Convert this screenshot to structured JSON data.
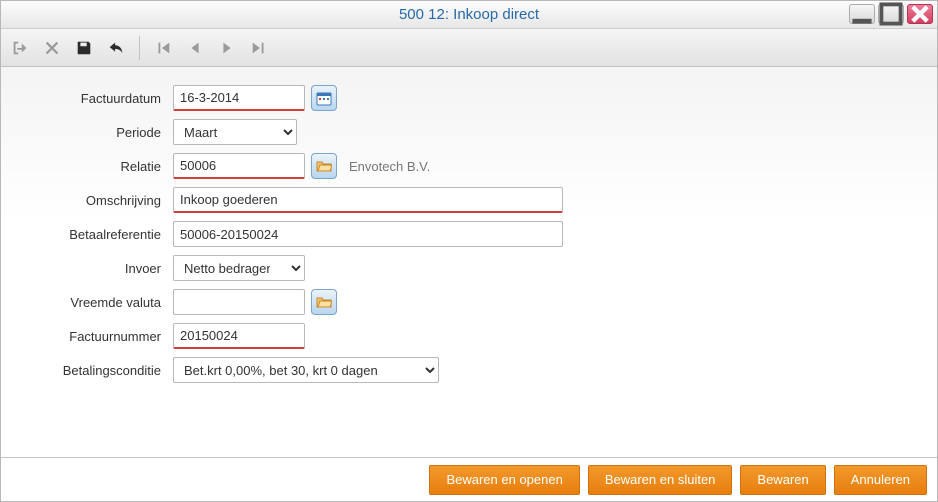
{
  "window": {
    "title": "500 12: Inkoop direct"
  },
  "form": {
    "factuurdatum": {
      "label": "Factuurdatum",
      "value": "16-3-2014"
    },
    "periode": {
      "label": "Periode",
      "value": "Maart"
    },
    "relatie": {
      "label": "Relatie",
      "value": "50006",
      "name": "Envotech B.V."
    },
    "omschrijving": {
      "label": "Omschrijving",
      "value": "Inkoop goederen"
    },
    "betaalref": {
      "label": "Betaalreferentie",
      "value": "50006-20150024"
    },
    "invoer": {
      "label": "Invoer",
      "value": "Netto bedragen"
    },
    "valuta": {
      "label": "Vreemde valuta",
      "value": ""
    },
    "factuurnr": {
      "label": "Factuurnummer",
      "value": "20150024"
    },
    "betcond": {
      "label": "Betalingsconditie",
      "value": "Bet.krt 0,00%, bet 30, krt 0 dagen"
    }
  },
  "buttons": {
    "open": "Bewaren en openen",
    "close": "Bewaren en sluiten",
    "save": "Bewaren",
    "cancel": "Annuleren"
  }
}
